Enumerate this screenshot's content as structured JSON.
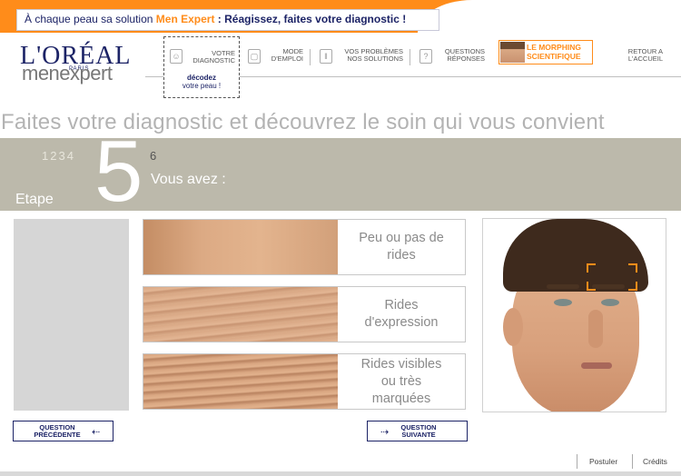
{
  "banner": {
    "prefix": "À chaque peau sa solution ",
    "brand": "Men Expert",
    "suffix": " : Réagissez, faites votre diagnostic !"
  },
  "logo": {
    "brand": "L'ORÉAL",
    "city": "PARIS",
    "line": "menexpert"
  },
  "nav": {
    "diagnostic": {
      "line1": "VOTRE",
      "line2": "DIAGNOSTIC",
      "sub1": "décodez",
      "sub2": "votre peau !"
    },
    "mode": {
      "line1": "MODE",
      "line2": "D'EMPLOI"
    },
    "problems": {
      "line1": "VOS PROBLÈMES",
      "line2": "NOS SOLUTIONS"
    },
    "questions": {
      "line1": "QUESTIONS",
      "line2": "RÉPONSES"
    },
    "morphing": {
      "line1": "LE MORPHING",
      "line2": "SCIENTIFIQUE"
    },
    "home": {
      "line1": "RETOUR A",
      "line2": "L'ACCUEIL"
    }
  },
  "page": {
    "title": "Faites votre diagnostic et découvrez le soin qui vous convient"
  },
  "step": {
    "previous": "1234",
    "current": "5",
    "next": "6",
    "label": "Etape",
    "question": "Vous avez :"
  },
  "options": [
    {
      "label_line1": "Peu ou pas de",
      "label_line2": "rides",
      "label_line3": ""
    },
    {
      "label_line1": "Rides",
      "label_line2": "d'expression",
      "label_line3": ""
    },
    {
      "label_line1": "Rides visibles",
      "label_line2": "ou très",
      "label_line3": "marquées"
    }
  ],
  "buttons": {
    "previous": {
      "line1": "QUESTION",
      "line2": "PRÉCÉDENTE"
    },
    "next": {
      "line1": "QUESTION",
      "line2": "SUIVANTE"
    }
  },
  "footer": {
    "postuler": "Postuler",
    "credits": "Crédits"
  },
  "colors": {
    "accent": "#ff8c1a",
    "brand_navy": "#1c2366",
    "band": "#bcb9ab"
  }
}
